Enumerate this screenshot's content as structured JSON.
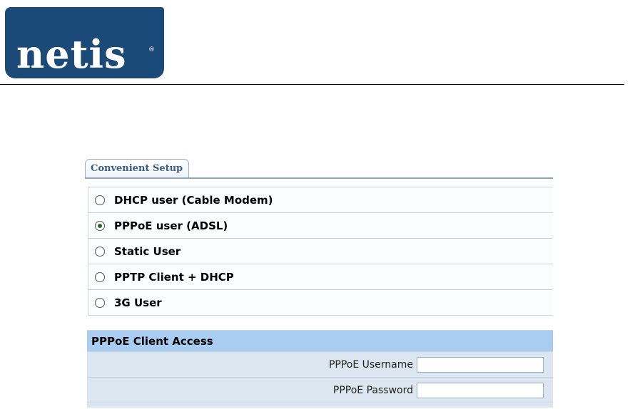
{
  "brand": {
    "logo_text": "netis",
    "logo_mark": "®"
  },
  "tab": {
    "label": "Convenient Setup"
  },
  "options": [
    {
      "label": "DHCP user (Cable Modem)",
      "checked": false
    },
    {
      "label": "PPPoE user (ADSL)",
      "checked": true
    },
    {
      "label": "Static User",
      "checked": false
    },
    {
      "label": "PPTP Client + DHCP",
      "checked": false
    },
    {
      "label": "3G User",
      "checked": false
    }
  ],
  "pppoe": {
    "header": "PPPoE Client Access",
    "username_label": "PPPoE Username",
    "username_value": "",
    "password_label": "PPPoE Password",
    "password_value": ""
  },
  "colors": {
    "logo_bg": "#1b4a78",
    "section_header_bg": "#a8cdf0",
    "row_bg": "#dbe6f1",
    "tab_text": "#3b5e86"
  }
}
